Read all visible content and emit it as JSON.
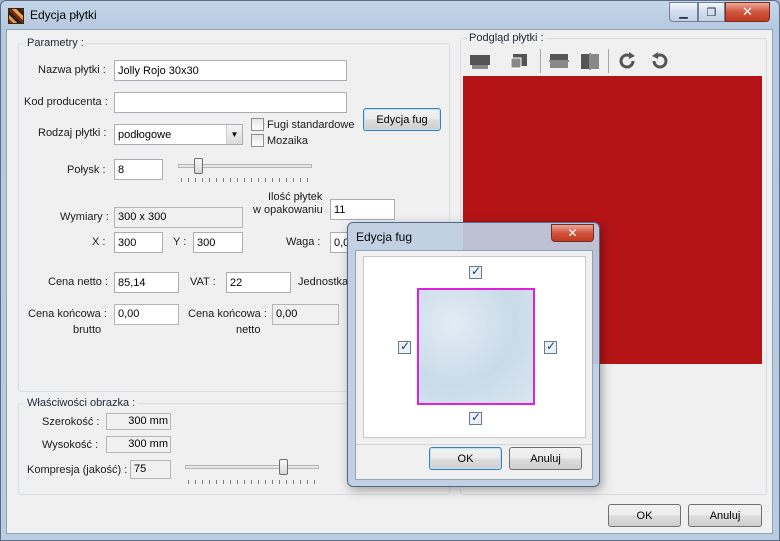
{
  "window": {
    "title": "Edycja płytki"
  },
  "parametry": {
    "legend": "Parametry :",
    "nazwa_label": "Nazwa płytki :",
    "nazwa_value": "Jolly Rojo 30x30",
    "kod_label": "Kod producenta :",
    "kod_value": "",
    "rodzaj_label": "Rodzaj płytki :",
    "rodzaj_value": "podłogowe",
    "fugi_std_label": "Fugi standardowe",
    "mozaika_label": "Mozaika",
    "edycja_fug_button": "Edycja fug",
    "polysk_label": "Połysk :",
    "polysk_value": "8",
    "polysk_fraction": 0.08,
    "ilosc_label_1": "Ilość płytek",
    "ilosc_label_2": "w opakowaniu",
    "ilosc_value": "11",
    "wymiary_label": "Wymiary :",
    "wymiary_value": "300 x 300",
    "x_label": "X :",
    "x_value": "300",
    "y_label": "Y :",
    "y_value": "300",
    "waga_label": "Waga :",
    "waga_value": "0,0",
    "cena_netto_label": "Cena netto :",
    "cena_netto_value": "85,14",
    "vat_label": "VAT :",
    "vat_value": "22",
    "jednostka_label": "Jednostka",
    "cena_koncowa_brutto_label_1": "Cena końcowa :",
    "cena_koncowa_brutto_label_2": "brutto",
    "cena_koncowa_brutto_value": "0,00",
    "cena_koncowa_netto_label_1": "Cena końcowa :",
    "cena_koncowa_netto_label_2": "netto",
    "cena_koncowa_netto_value": "0,00"
  },
  "obrazek": {
    "legend": "Właściwości obrazka :",
    "szerokosc_label": "Szerokość :",
    "szerokosc_value": "300 mm",
    "wysokosc_label": "Wysokość :",
    "wysokosc_value": "300 mm",
    "kompresja_label": "Kompresja (jakość) :",
    "kompresja_value": "75",
    "kompresja_fraction": 0.75
  },
  "podglad": {
    "legend": "Podgląd płytki :",
    "tile_color": "#b41416"
  },
  "dialog": {
    "title": "Edycja fug",
    "ok_button": "OK",
    "cancel_button": "Anuluj",
    "swatch_border_color": "#e020e0"
  },
  "footer": {
    "ok_button": "OK",
    "cancel_button": "Anuluj"
  }
}
